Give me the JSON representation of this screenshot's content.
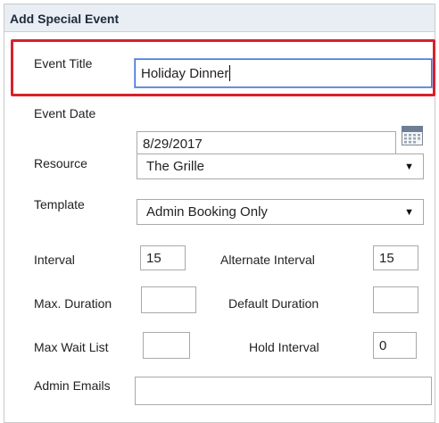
{
  "panel": {
    "title": "Add Special Event"
  },
  "fields": {
    "event_title": {
      "label": "Event Title",
      "value": "Holiday Dinner"
    },
    "event_date": {
      "label": "Event Date",
      "value": "8/29/2017"
    },
    "resource": {
      "label": "Resource",
      "value": "The Grille"
    },
    "template": {
      "label": "Template",
      "value": "Admin Booking Only"
    },
    "interval": {
      "label": "Interval",
      "value": "15"
    },
    "alternate_interval": {
      "label": "Alternate Interval",
      "value": "15"
    },
    "max_duration": {
      "label": "Max. Duration",
      "value": ""
    },
    "default_duration": {
      "label": "Default Duration",
      "value": ""
    },
    "max_wait_list": {
      "label": "Max Wait List",
      "value": ""
    },
    "hold_interval": {
      "label": "Hold Interval",
      "value": "0"
    },
    "admin_emails": {
      "label": "Admin Emails",
      "value": ""
    }
  },
  "icons": {
    "calendar": "calendar-icon",
    "dropdown": "triangle-down"
  },
  "colors": {
    "header_bg": "#e9eef5",
    "highlight": "#d9212b",
    "focus": "#3f6fd1"
  }
}
